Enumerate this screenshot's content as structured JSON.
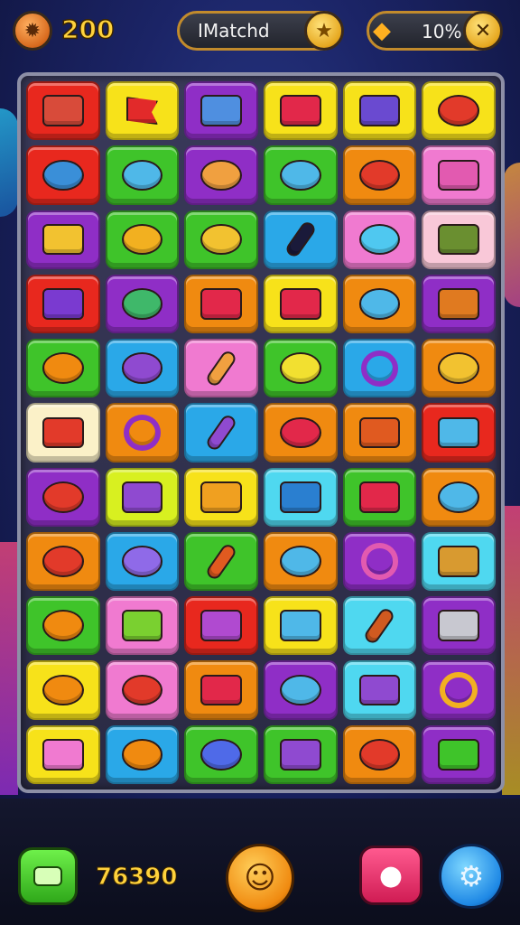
{
  "hud": {
    "coin_icon": "coin-icon",
    "score": "200",
    "title": "IMatchd",
    "title_badge_icon": "star-badge-icon",
    "resource_icon": "carrot-icon",
    "resource_value": "10%",
    "close_icon": "close-icon"
  },
  "board": {
    "rows": 11,
    "cols": 6,
    "tiles": [
      {
        "bg": "#e8281e",
        "ic": "#d84b3a",
        "shape": "square",
        "name": "bed-icon"
      },
      {
        "bg": "#f7e21a",
        "ic": "#e22a2a",
        "shape": "flag",
        "name": "flag-icon"
      },
      {
        "bg": "#8f2ec6",
        "ic": "#4f8fe0",
        "shape": "square",
        "name": "box-icon"
      },
      {
        "bg": "#f7e21a",
        "ic": "#e2284a",
        "shape": "square",
        "name": "candy-icon"
      },
      {
        "bg": "#f7e21a",
        "ic": "#6a4ad0",
        "shape": "square",
        "name": "bag-icon"
      },
      {
        "bg": "#f7e21a",
        "ic": "#e23a2a",
        "shape": "round",
        "name": "strawberry-icon"
      },
      {
        "bg": "#e8281e",
        "ic": "#3a8fd8",
        "shape": "round",
        "name": "fish-icon"
      },
      {
        "bg": "#3fc42a",
        "ic": "#4fb8e8",
        "shape": "round",
        "name": "leaf-icon"
      },
      {
        "bg": "#8f2ec6",
        "ic": "#f0a040",
        "shape": "round",
        "name": "croissant-icon"
      },
      {
        "bg": "#3fc42a",
        "ic": "#4fb8e8",
        "shape": "round",
        "name": "oval-sign-icon"
      },
      {
        "bg": "#f08a10",
        "ic": "#e23a2a",
        "shape": "round",
        "name": "crab-icon"
      },
      {
        "bg": "#f07ad0",
        "ic": "#e25ab0",
        "shape": "square",
        "name": "sofa-icon"
      },
      {
        "bg": "#8f2ec6",
        "ic": "#f2c230",
        "shape": "square",
        "name": "toast-icon"
      },
      {
        "bg": "#3fc42a",
        "ic": "#f2b020",
        "shape": "round",
        "name": "lemon-icon"
      },
      {
        "bg": "#3fc42a",
        "ic": "#f2c230",
        "shape": "round",
        "name": "star-icon"
      },
      {
        "bg": "#2aa8e8",
        "ic": "#1a1a3a",
        "shape": "stick",
        "name": "wand-icon"
      },
      {
        "bg": "#f07ad0",
        "ic": "#4fc8f0",
        "shape": "round",
        "name": "bowl-icon"
      },
      {
        "bg": "#f9c8d8",
        "ic": "#6a8f30",
        "shape": "square",
        "name": "tools-icon"
      },
      {
        "bg": "#e8281e",
        "ic": "#7a3ad0",
        "shape": "square",
        "name": "ticket-icon"
      },
      {
        "bg": "#8f2ec6",
        "ic": "#3fb86a",
        "shape": "round",
        "name": "turtle-icon"
      },
      {
        "bg": "#f08a10",
        "ic": "#e2284a",
        "shape": "square",
        "name": "comb-icon"
      },
      {
        "bg": "#f7e21a",
        "ic": "#e2284a",
        "shape": "square",
        "name": "sign-icon"
      },
      {
        "bg": "#f08a10",
        "ic": "#4fb8e8",
        "shape": "round",
        "name": "magnifier-icon"
      },
      {
        "bg": "#8f2ec6",
        "ic": "#e07a20",
        "shape": "square",
        "name": "cabinet-icon"
      },
      {
        "bg": "#3fc42a",
        "ic": "#f08a10",
        "shape": "round",
        "name": "bear-icon"
      },
      {
        "bg": "#2aa8e8",
        "ic": "#8f4ad0",
        "shape": "round",
        "name": "cat-icon"
      },
      {
        "bg": "#f07ad0",
        "ic": "#f0a040",
        "shape": "stick",
        "name": "brush-icon"
      },
      {
        "bg": "#3fc42a",
        "ic": "#f2e030",
        "shape": "round",
        "name": "sponge-icon"
      },
      {
        "bg": "#2aa8e8",
        "ic": "#8f2ec6",
        "shape": "ring",
        "name": "ring-icon"
      },
      {
        "bg": "#f08a10",
        "ic": "#f2c230",
        "shape": "round",
        "name": "pear-icon"
      },
      {
        "bg": "#fbf1c8",
        "ic": "#e23a2a",
        "shape": "square",
        "name": "bed-icon"
      },
      {
        "bg": "#f08a10",
        "ic": "#8f2ec6",
        "shape": "ring",
        "name": "ring-icon"
      },
      {
        "bg": "#2aa8e8",
        "ic": "#8f4ad0",
        "shape": "stick",
        "name": "bottle-icon"
      },
      {
        "bg": "#f08a10",
        "ic": "#e2284a",
        "shape": "round",
        "name": "bowl-icon"
      },
      {
        "bg": "#f08a10",
        "ic": "#e05a20",
        "shape": "square",
        "name": "sign-icon"
      },
      {
        "bg": "#e8281e",
        "ic": "#4fb8e8",
        "shape": "square",
        "name": "jar-icon"
      },
      {
        "bg": "#8f2ec6",
        "ic": "#e23a2a",
        "shape": "round",
        "name": "apple-icon"
      },
      {
        "bg": "#d8f020",
        "ic": "#8f4ad0",
        "shape": "square",
        "name": "box-icon"
      },
      {
        "bg": "#f7e21a",
        "ic": "#f0a020",
        "shape": "square",
        "name": "tray-icon"
      },
      {
        "bg": "#4fd8f0",
        "ic": "#2a7fd0",
        "shape": "square",
        "name": "label-icon"
      },
      {
        "bg": "#3fc42a",
        "ic": "#e2284a",
        "shape": "square",
        "name": "radio-icon"
      },
      {
        "bg": "#f08a10",
        "ic": "#4fb8e8",
        "shape": "round",
        "name": "leaf-icon"
      },
      {
        "bg": "#f08a10",
        "ic": "#e23a2a",
        "shape": "round",
        "name": "crab-icon"
      },
      {
        "bg": "#2aa8e8",
        "ic": "#8f6ae8",
        "shape": "round",
        "name": "ball-icon"
      },
      {
        "bg": "#3fc42a",
        "ic": "#e05a20",
        "shape": "stick",
        "name": "pencil-icon"
      },
      {
        "bg": "#f08a10",
        "ic": "#4fb8e8",
        "shape": "round",
        "name": "glasses-icon"
      },
      {
        "bg": "#8f2ec6",
        "ic": "#e25ab0",
        "shape": "ring",
        "name": "sign-circle-icon"
      },
      {
        "bg": "#4fd8f0",
        "ic": "#d89a30",
        "shape": "square",
        "name": "board-icon"
      },
      {
        "bg": "#3fc42a",
        "ic": "#f08a10",
        "shape": "round",
        "name": "carrot-icon"
      },
      {
        "bg": "#f07ad0",
        "ic": "#7ad030",
        "shape": "square",
        "name": "book-icon"
      },
      {
        "bg": "#e8281e",
        "ic": "#b04ad0",
        "shape": "square",
        "name": "case-icon"
      },
      {
        "bg": "#f7e21a",
        "ic": "#4fb8e8",
        "shape": "square",
        "name": "map-icon"
      },
      {
        "bg": "#4fd8f0",
        "ic": "#d05a20",
        "shape": "stick",
        "name": "sausage-icon"
      },
      {
        "bg": "#8f2ec6",
        "ic": "#c8c8d0",
        "shape": "square",
        "name": "cabinet-icon"
      },
      {
        "bg": "#f7e21a",
        "ic": "#f08a10",
        "shape": "round",
        "name": "bear-icon"
      },
      {
        "bg": "#f07ad0",
        "ic": "#e23a2a",
        "shape": "round",
        "name": "tomato-icon"
      },
      {
        "bg": "#f08a10",
        "ic": "#e2284a",
        "shape": "square",
        "name": "dragon-icon"
      },
      {
        "bg": "#8f2ec6",
        "ic": "#4fb8e8",
        "shape": "round",
        "name": "leaf-icon"
      },
      {
        "bg": "#4fd8f0",
        "ic": "#8f4ad0",
        "shape": "square",
        "name": "tag-icon"
      },
      {
        "bg": "#8f2ec6",
        "ic": "#f2b020",
        "shape": "ring",
        "name": "mirror-icon"
      },
      {
        "bg": "#f7e21a",
        "ic": "#f07ad0",
        "shape": "square",
        "name": "pig-icon"
      },
      {
        "bg": "#2aa8e8",
        "ic": "#f08a10",
        "shape": "round",
        "name": "orange-icon"
      },
      {
        "bg": "#3fc42a",
        "ic": "#4f6ae8",
        "shape": "round",
        "name": "fish-icon"
      },
      {
        "bg": "#3fc42a",
        "ic": "#8f4ad0",
        "shape": "square",
        "name": "envelope-icon"
      },
      {
        "bg": "#f08a10",
        "ic": "#e23a2a",
        "shape": "round",
        "name": "pot-icon"
      },
      {
        "bg": "#8f2ec6",
        "ic": "#3fc42a",
        "shape": "square",
        "name": "cube-icon"
      }
    ]
  },
  "bottom": {
    "shop_icon": "ticket-icon",
    "score": "76390",
    "hint_icon": "magnifier-face-icon",
    "booster_icon": "creature-icon",
    "settings_icon": "gear-icon"
  },
  "colors": {
    "gold": "#ffd23c",
    "frame": "#c28b2c",
    "background": "#1b2466"
  }
}
